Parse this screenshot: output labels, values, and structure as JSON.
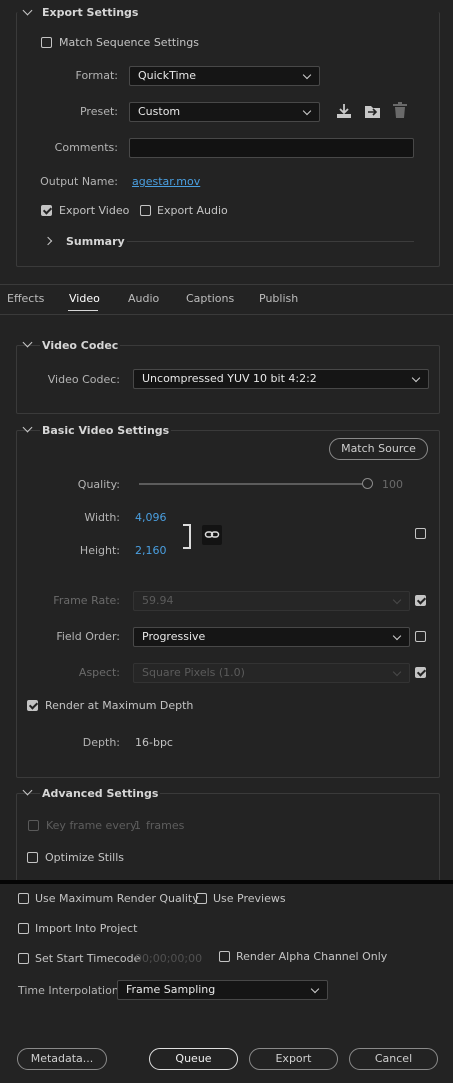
{
  "export_settings": {
    "title": "Export Settings",
    "match_sequence_label": "Match Sequence Settings",
    "format_label": "Format:",
    "format_value": "QuickTime",
    "preset_label": "Preset:",
    "preset_value": "Custom",
    "comments_label": "Comments:",
    "comments_value": "",
    "output_name_label": "Output Name:",
    "output_name_value": "agestar.mov",
    "export_video_label": "Export Video",
    "export_video_checked": true,
    "export_audio_label": "Export Audio",
    "export_audio_checked": false,
    "summary_label": "Summary"
  },
  "tabs": [
    "Effects",
    "Video",
    "Audio",
    "Captions",
    "Publish"
  ],
  "active_tab": "Video",
  "video_codec": {
    "title": "Video Codec",
    "label": "Video Codec:",
    "value": "Uncompressed YUV 10 bit 4:2:2"
  },
  "basic_video": {
    "title": "Basic Video Settings",
    "match_source_label": "Match Source",
    "quality_label": "Quality:",
    "quality_value": "100",
    "width_label": "Width:",
    "width_value": "4,096",
    "height_label": "Height:",
    "height_value": "2,160",
    "frame_rate_label": "Frame Rate:",
    "frame_rate_value": "59.94",
    "field_order_label": "Field Order:",
    "field_order_value": "Progressive",
    "aspect_label": "Aspect:",
    "aspect_value": "Square Pixels (1.0)",
    "render_max_depth_label": "Render at Maximum Depth",
    "depth_label": "Depth:",
    "depth_value": "16-bpc"
  },
  "advanced": {
    "title": "Advanced Settings",
    "keyframe_label": "Key frame every",
    "keyframe_value": "1",
    "keyframe_unit": "frames",
    "optimize_stills_label": "Optimize Stills"
  },
  "bottom": {
    "max_render_quality_label": "Use Maximum Render Quality",
    "use_previews_label": "Use Previews",
    "import_project_label": "Import Into Project",
    "set_start_timecode_label": "Set Start Timecode",
    "timecode_value": "00;00;00;00",
    "render_alpha_label": "Render Alpha Channel Only",
    "time_interp_label": "Time Interpolation:",
    "time_interp_value": "Frame Sampling"
  },
  "buttons": {
    "metadata": "Metadata...",
    "queue": "Queue",
    "export": "Export",
    "cancel": "Cancel"
  },
  "icons": {
    "save_preset": "download-tray-icon",
    "import_preset": "folder-arrow-icon",
    "delete_preset": "trash-icon",
    "link": "chain-link-icon"
  }
}
